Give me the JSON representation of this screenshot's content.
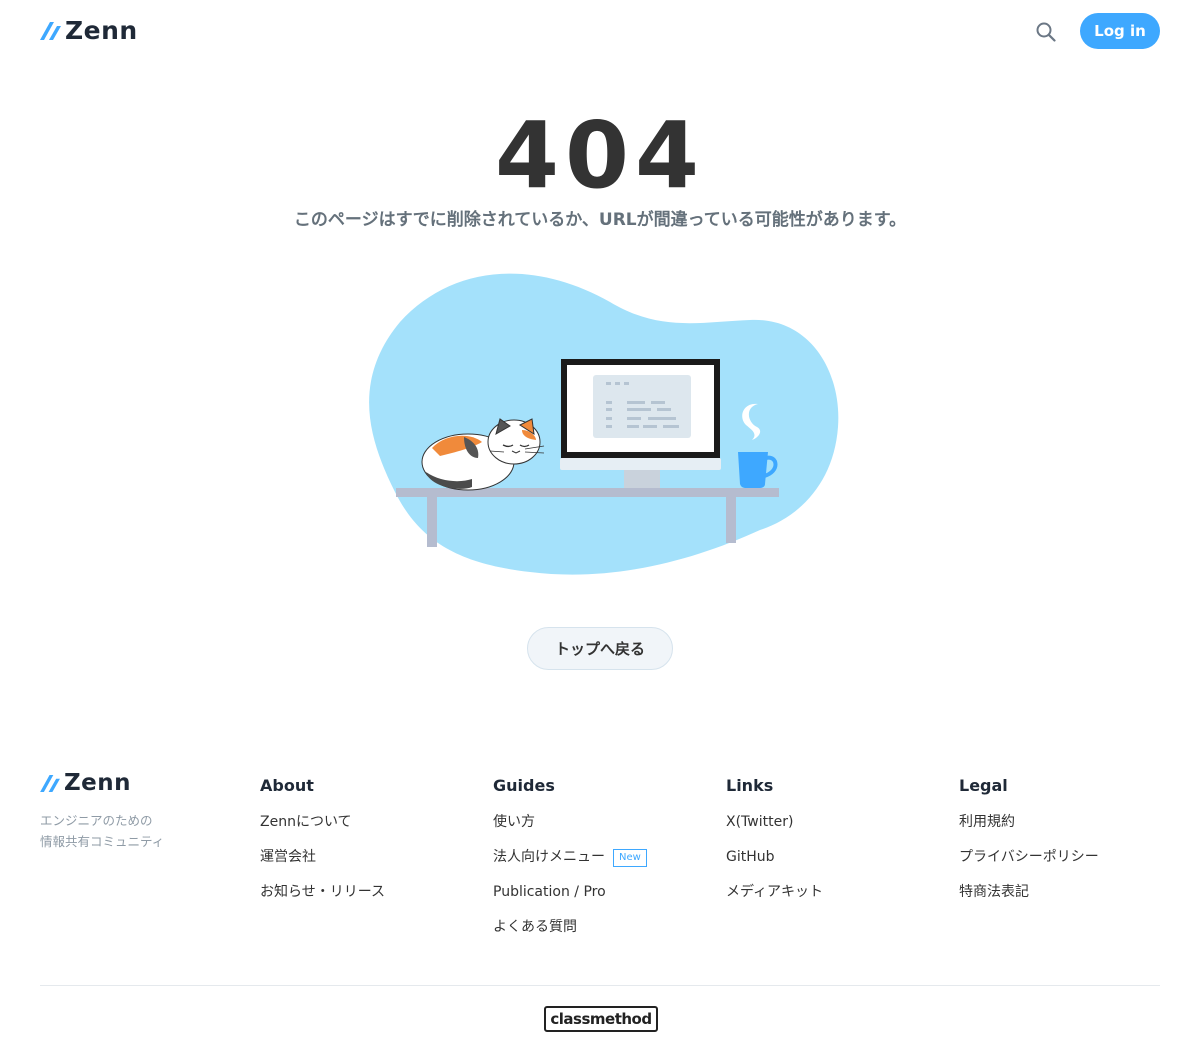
{
  "header": {
    "logo_text": "Zenn",
    "search_icon": "search-icon",
    "login_label": "Log in"
  },
  "error": {
    "code": "404",
    "message": "このページはすでに削除されているか、URLが間違っている可能性があります。"
  },
  "illustration": {
    "description_icon": "cat-computer-illustration"
  },
  "back_button_label": "トップへ戻る",
  "footer": {
    "logo_text": "Zenn",
    "tagline_line1": "エンジニアのための",
    "tagline_line2": "情報共有コミュニティ",
    "columns": [
      {
        "title": "About",
        "items": [
          "Zennについて",
          "運営会社",
          "お知らせ・リリース"
        ]
      },
      {
        "title": "Guides",
        "items": [
          "使い方",
          "法人向けメニュー",
          "Publication / Pro",
          "よくある質問"
        ],
        "badge": "New"
      },
      {
        "title": "Links",
        "items": [
          "X(Twitter)",
          "GitHub",
          "メディアキット"
        ]
      },
      {
        "title": "Legal",
        "items": [
          "利用規約",
          "プライバシーポリシー",
          "特商法表記"
        ]
      }
    ],
    "bottom_logo_text": "classmethod"
  },
  "colors": {
    "accent": "#3ea8ff",
    "blob": "#a4e1fb",
    "text": "#333333"
  }
}
